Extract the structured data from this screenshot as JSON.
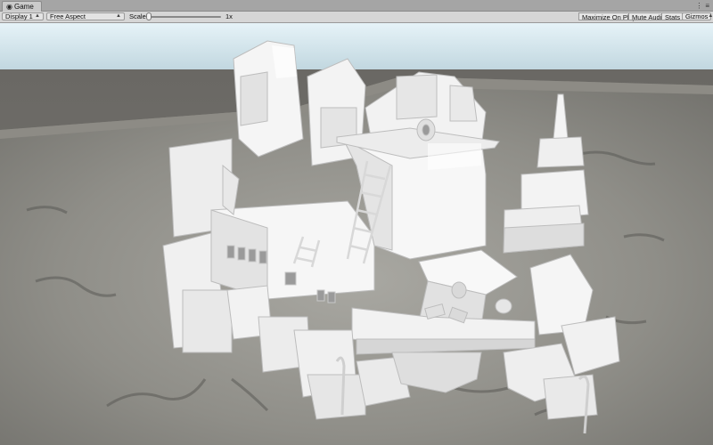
{
  "window": {
    "tab_label": "Game",
    "tab_icon": "game-icon"
  },
  "toolbar": {
    "display_label": "Display 1",
    "aspect_label": "Free Aspect",
    "scale_label": "Scale",
    "scale_value": "1x",
    "scale_fraction": 0.0,
    "maximize_label": "Maximize On Play",
    "mute_label": "Mute Audio",
    "stats_label": "Stats",
    "gizmos_label": "Gizmos"
  },
  "colors": {
    "sky_top": "#e6f3f8",
    "sky_horizon": "#c4dbe3",
    "ground": "#6e6d69",
    "model": "#f4f4f4",
    "model_shade": "#d4d4d4"
  }
}
